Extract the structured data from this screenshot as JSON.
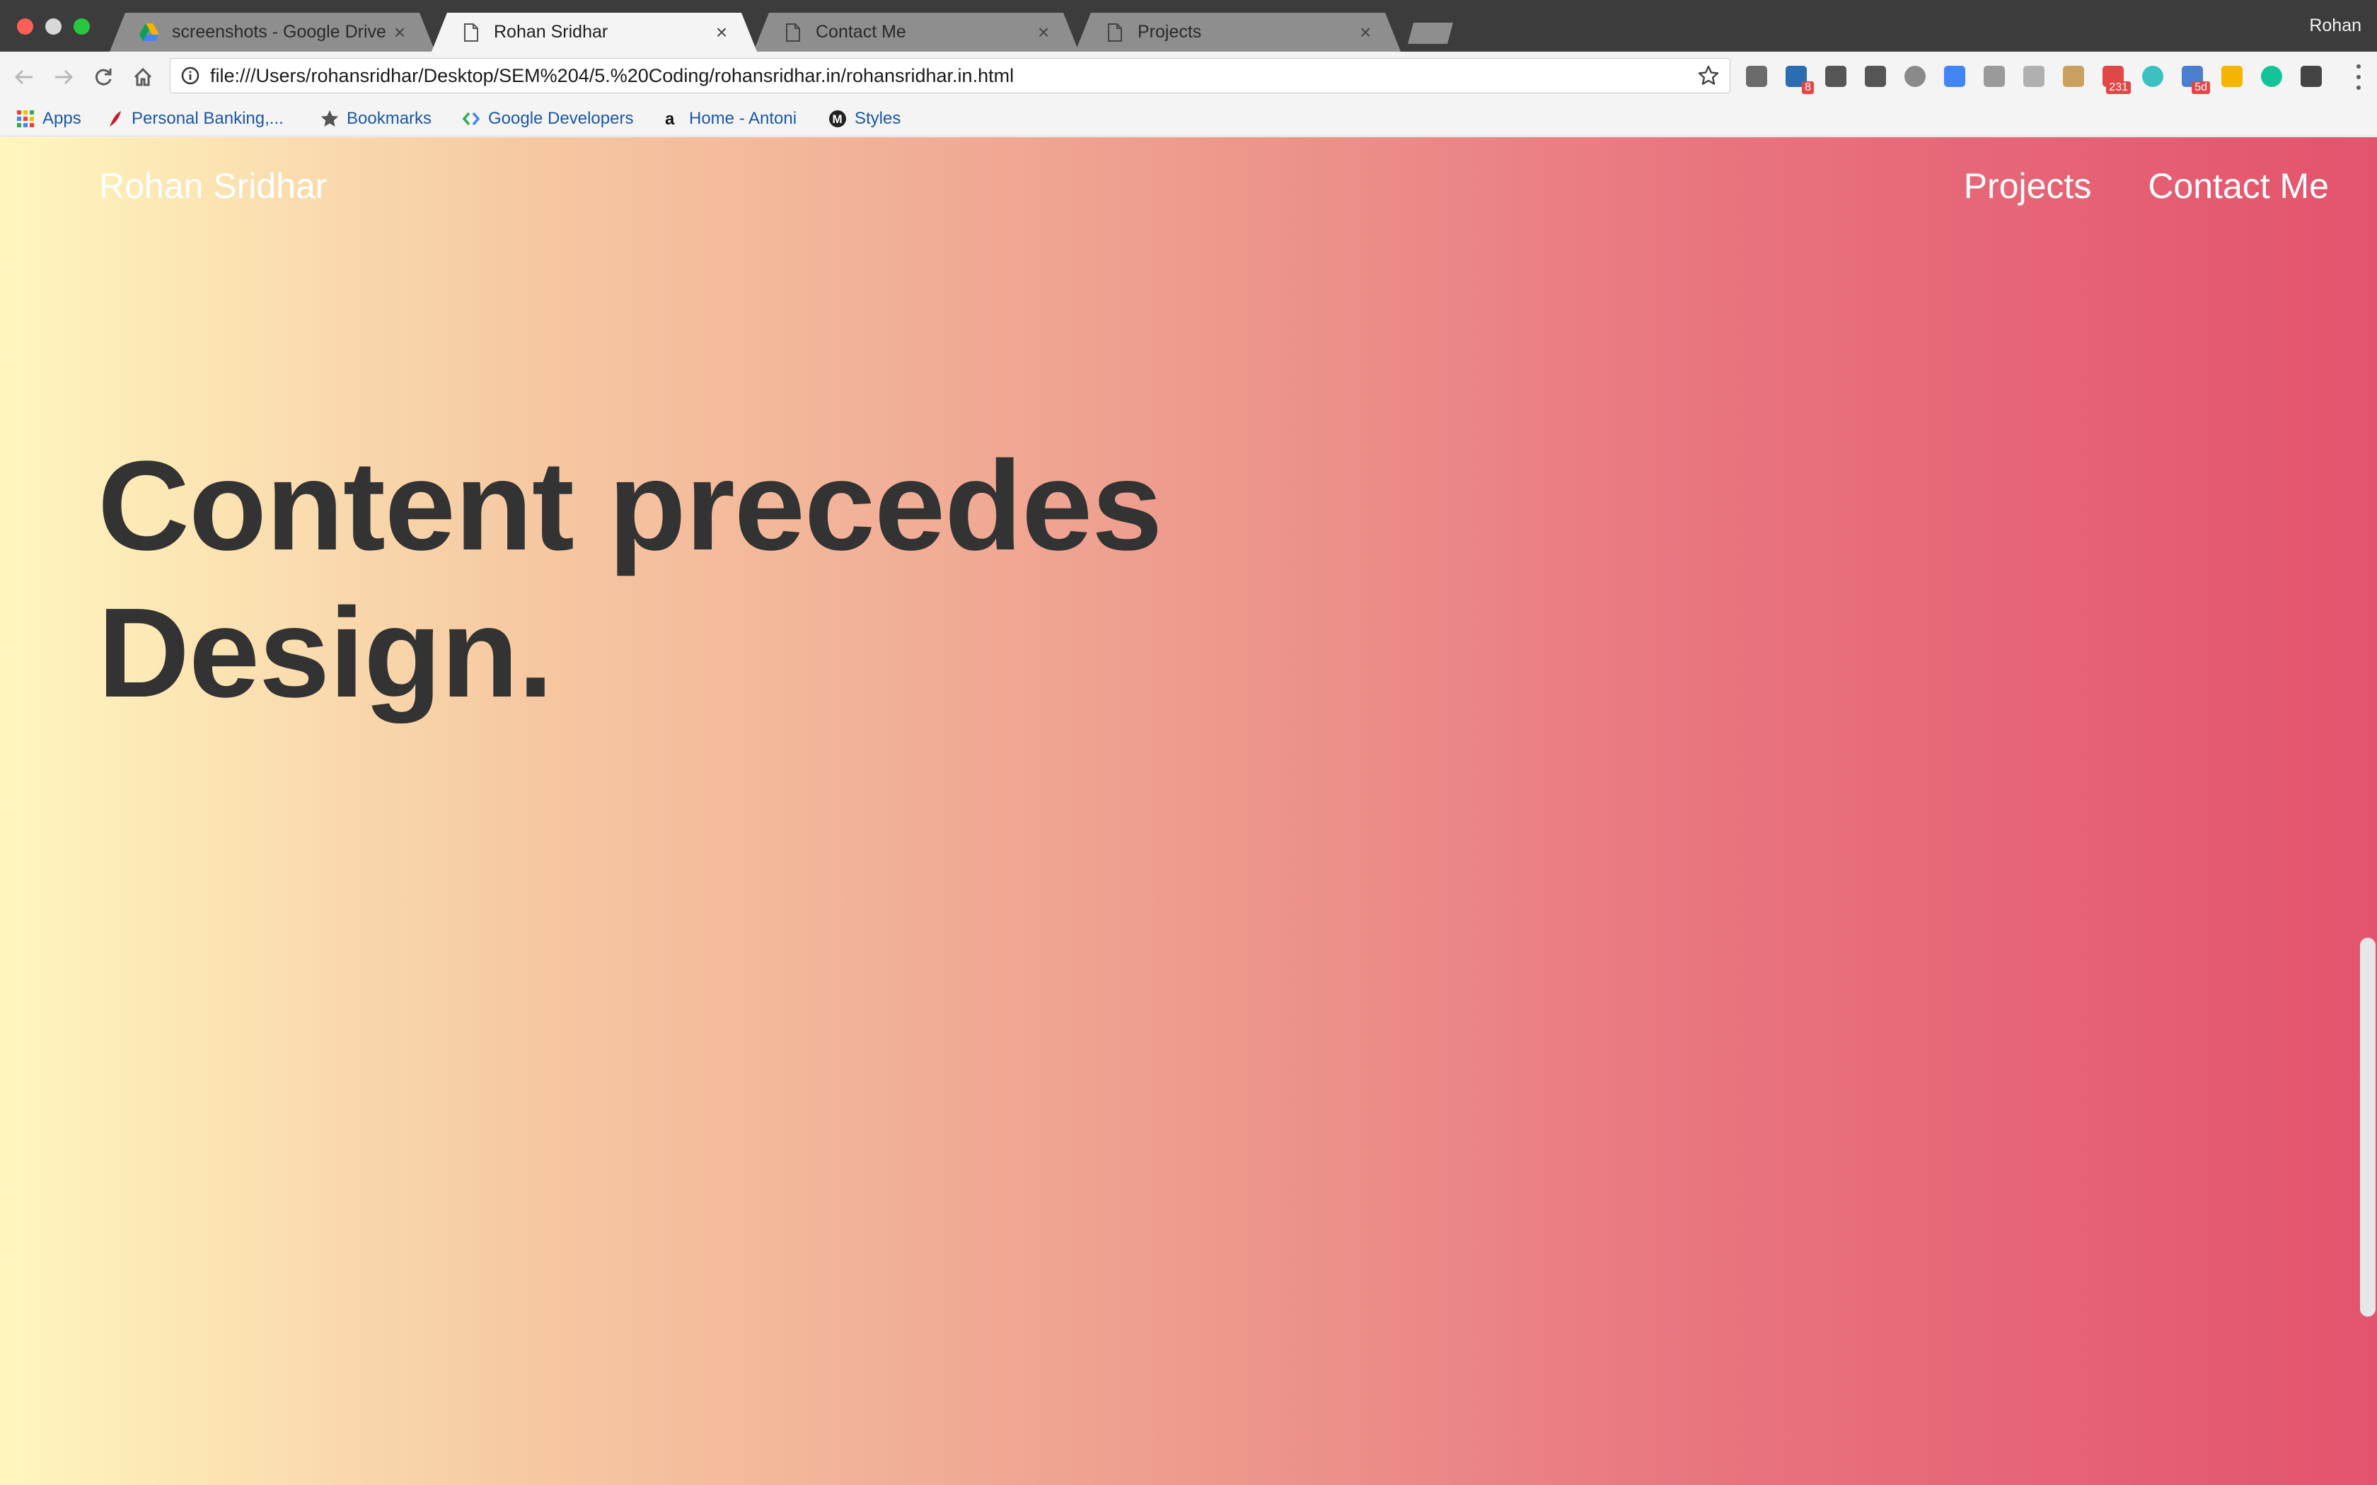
{
  "browser": {
    "profile_name": "Rohan",
    "tabs": [
      {
        "title": "screenshots - Google Drive",
        "icon": "google-drive-icon",
        "active": false
      },
      {
        "title": "Rohan Sridhar",
        "icon": "page-icon",
        "active": true
      },
      {
        "title": "Contact Me",
        "icon": "page-icon",
        "active": false
      },
      {
        "title": "Projects",
        "icon": "page-icon",
        "active": false
      }
    ],
    "tab_close_glyph": "×",
    "url": "file:///Users/rohansridhar/Desktop/SEM%204/5.%20Coding/rohansridhar.in/rohansridhar.in.html",
    "extensions": [
      {
        "name": "lightbulb-extension-icon",
        "color": "#6b6b6b"
      },
      {
        "name": "linkedin-extension-icon",
        "color": "#2a6db0",
        "badge": "8"
      },
      {
        "name": "keep-extension-icon",
        "color": "#555555"
      },
      {
        "name": "film-extension-icon",
        "color": "#555555"
      },
      {
        "name": "chat-bubble-extension-icon",
        "color": "#8a8a8a"
      },
      {
        "name": "translate-extension-icon",
        "color": "#4285f4"
      },
      {
        "name": "window-extension-icon",
        "color": "#9a9a9a"
      },
      {
        "name": "camera-extension-icon",
        "color": "#b0b0b0"
      },
      {
        "name": "eyedropper-extension-icon",
        "color": "#c9a060"
      },
      {
        "name": "calendar-badge-extension-icon",
        "color": "#e04848",
        "badge": "231"
      },
      {
        "name": "m-circle-extension-icon",
        "color": "#3cc0c0"
      },
      {
        "name": "calendar-extension-icon",
        "color": "#4a7fd0",
        "badge": "5d"
      },
      {
        "name": "google-drive-extension-icon",
        "color": "#f4b400"
      },
      {
        "name": "grammarly-extension-icon",
        "color": "#15c39a"
      },
      {
        "name": "function-extension-icon",
        "color": "#444444"
      }
    ],
    "bookmarks": [
      {
        "label": "Apps",
        "icon": "apps-grid-icon"
      },
      {
        "label": "Personal Banking,...",
        "icon": "bank-icon"
      },
      {
        "label": "Bookmarks",
        "icon": "star-icon"
      },
      {
        "label": "Google Developers",
        "icon": "google-developers-icon"
      },
      {
        "label": "Home - Antoni",
        "icon": "amazon-icon"
      },
      {
        "label": "Styles",
        "icon": "styles-icon"
      }
    ]
  },
  "site": {
    "logo": "Rohan Sridhar",
    "nav": [
      "Projects",
      "Contact Me"
    ],
    "hero_line_1": "Content precedes",
    "hero_line_2": "Design."
  }
}
